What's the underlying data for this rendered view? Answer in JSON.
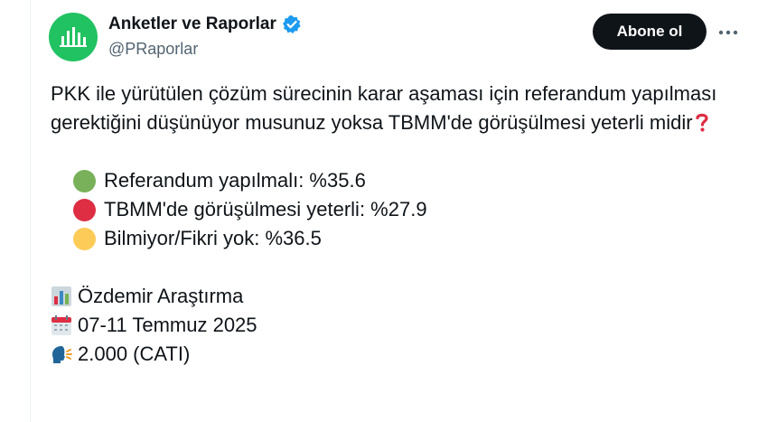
{
  "account": {
    "display_name": "Anketler ve Raporlar",
    "handle": "@PRaporlar",
    "verified": true,
    "avatar_color": "#21c262",
    "verified_color": "#1d9bf0"
  },
  "actions": {
    "follow_label": "Abone ol",
    "more_icon": "more-horizontal-icon"
  },
  "tweet": {
    "question": "PKK ile yürütülen çözüm sürecinin karar aşaması için referandum yapılması gerektiğini düşünüyor musunuz yoksa TBMM'de görüşülmesi yeterli midir",
    "question_emoji": "red-question-mark-icon",
    "options": [
      {
        "label": "Referandum yapılmalı: %35.6",
        "color": "#78b159"
      },
      {
        "label": "TBMM'de görüşülmesi yeterli: %27.9",
        "color": "#dd2e44"
      },
      {
        "label": "Bilmiyor/Fikri yok: %36.5",
        "color": "#fdcb58"
      }
    ],
    "source": "Özdemir Araştırma",
    "source_icon": "bar-chart-icon",
    "date": "07-11 Temmuz 2025",
    "date_icon": "calendar-icon",
    "sample": "2.000 (CATI)",
    "sample_icon": "speaking-head-icon"
  }
}
